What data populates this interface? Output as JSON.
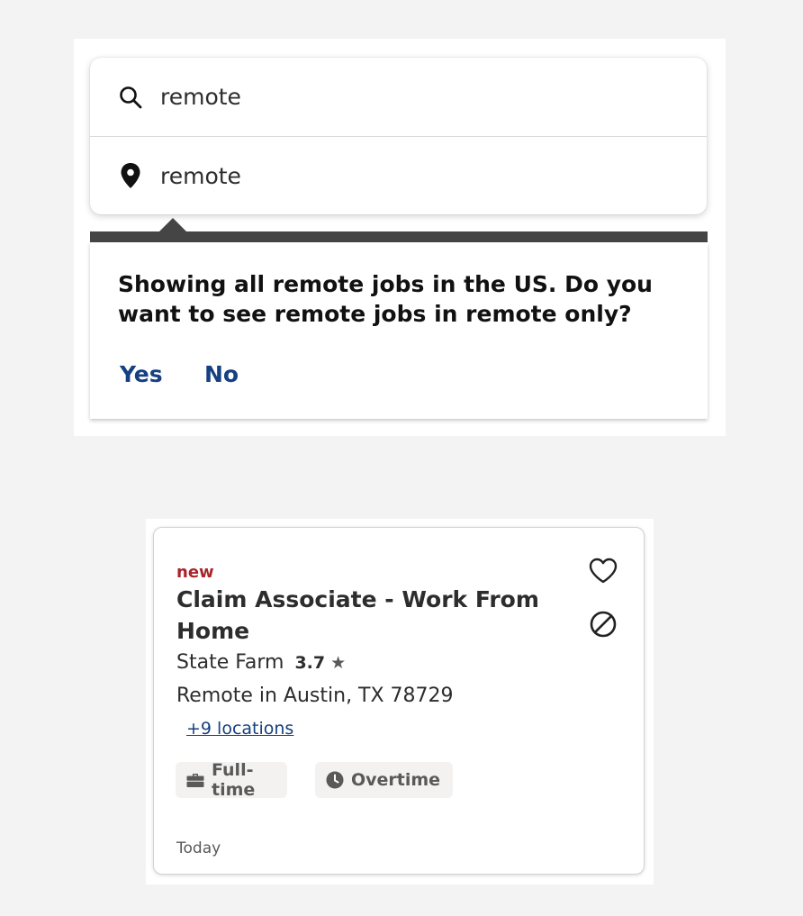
{
  "search": {
    "what_value": "remote",
    "where_value": "remote"
  },
  "tooltip": {
    "message": "Showing all remote jobs in the US. Do you want to see remote jobs in remote only?",
    "yes_label": "Yes",
    "no_label": "No"
  },
  "job_card": {
    "badge": "new",
    "title": "Claim Associate - Work From Home",
    "company": "State Farm",
    "rating": "3.7",
    "location": "Remote in Austin, TX 78729",
    "more_locations": "+9 locations",
    "tags": [
      {
        "label": "Full-time",
        "icon": "briefcase-icon"
      },
      {
        "label": "Overtime",
        "icon": "clock-icon"
      }
    ],
    "posted": "Today",
    "actions": {
      "save_icon": "heart-icon",
      "hide_icon": "block-icon"
    }
  },
  "colors": {
    "link_blue": "#164081",
    "new_badge_red": "#a9252b",
    "tooltip_bar": "#454545",
    "chip_bg": "#f3f2f1"
  }
}
